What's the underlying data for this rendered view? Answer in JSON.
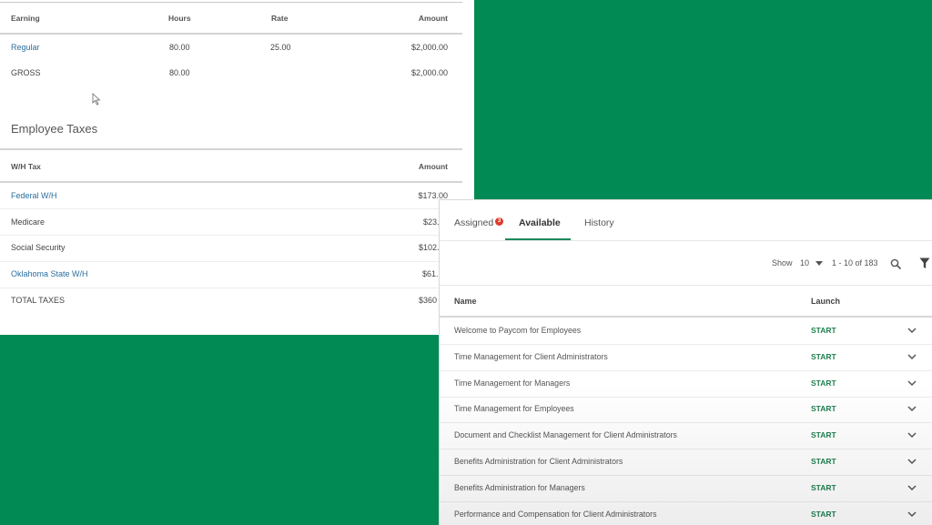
{
  "earnings": {
    "headers": {
      "earning": "Earning",
      "hours": "Hours",
      "rate": "Rate",
      "amount": "Amount"
    },
    "rows": [
      {
        "earning": "Regular",
        "hours": "80.00",
        "rate": "25.00",
        "amount": "$2,000.00"
      },
      {
        "earning": "GROSS",
        "hours": "80.00",
        "rate": "",
        "amount": "$2,000.00"
      }
    ]
  },
  "taxes": {
    "section_title": "Employee Taxes",
    "headers": {
      "tax": "W/H Tax",
      "amount": "Amount"
    },
    "rows": [
      {
        "tax": "Federal W/H",
        "amount": "$173.00"
      },
      {
        "tax": "Medicare",
        "amount": "$23."
      },
      {
        "tax": "Social Security",
        "amount": "$102."
      },
      {
        "tax": "Oklahoma State W/H",
        "amount": "$61."
      },
      {
        "tax": "TOTAL TAXES",
        "amount": "$360"
      }
    ]
  },
  "learning": {
    "tabs": [
      {
        "label": "Assigned",
        "badge": "3"
      },
      {
        "label": "Available"
      },
      {
        "label": "History"
      }
    ],
    "pager": {
      "show_label": "Show",
      "per_page": "10",
      "range": "1 - 10 of 183"
    },
    "columns": {
      "name": "Name",
      "launch": "Launch"
    },
    "start_label": "START",
    "courses": [
      "Welcome to Paycom for Employees",
      "Time Management for Client Administrators",
      "Time Management for Managers",
      "Time Management for Employees",
      "Document and Checklist Management for Client Administrators",
      "Benefits Administration for Client Administrators",
      "Benefits Administration for Managers",
      "Performance and Compensation for Client Administrators"
    ]
  },
  "colors": {
    "background": "#028a55",
    "accent_green": "#1d7f4f",
    "link_blue": "#2a6f9e",
    "badge_red": "#e03b2e"
  },
  "icons": [
    "cursor-icon",
    "search-icon",
    "filter-icon",
    "chevron-down-icon",
    "caret-down-icon"
  ]
}
